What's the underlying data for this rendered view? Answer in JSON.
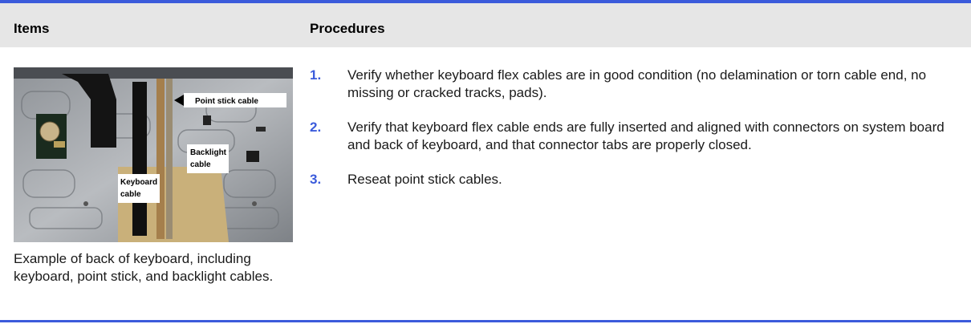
{
  "header": {
    "items_label": "Items",
    "procedures_label": "Procedures"
  },
  "item": {
    "image_labels": {
      "point_stick": "Point stick cable",
      "backlight_line1": "Backlight",
      "backlight_line2": "cable",
      "keyboard_line1": "Keyboard",
      "keyboard_line2": "cable"
    },
    "caption": "Example of back of keyboard, including keyboard, point stick, and backlight cables."
  },
  "procedures": [
    {
      "number": "1.",
      "text": "Verify whether keyboard flex cables are in good condition (no delamination or torn cable end, no missing or cracked tracks, pads)."
    },
    {
      "number": "2.",
      "text": "Verify that keyboard flex cable ends are fully inserted and aligned with connectors on system board and back of keyboard, and that connector tabs are properly closed."
    },
    {
      "number": "3.",
      "text": "Reseat point stick cables."
    }
  ],
  "colors": {
    "accent": "#3b5bdb",
    "header_bg": "#e6e6e6"
  }
}
